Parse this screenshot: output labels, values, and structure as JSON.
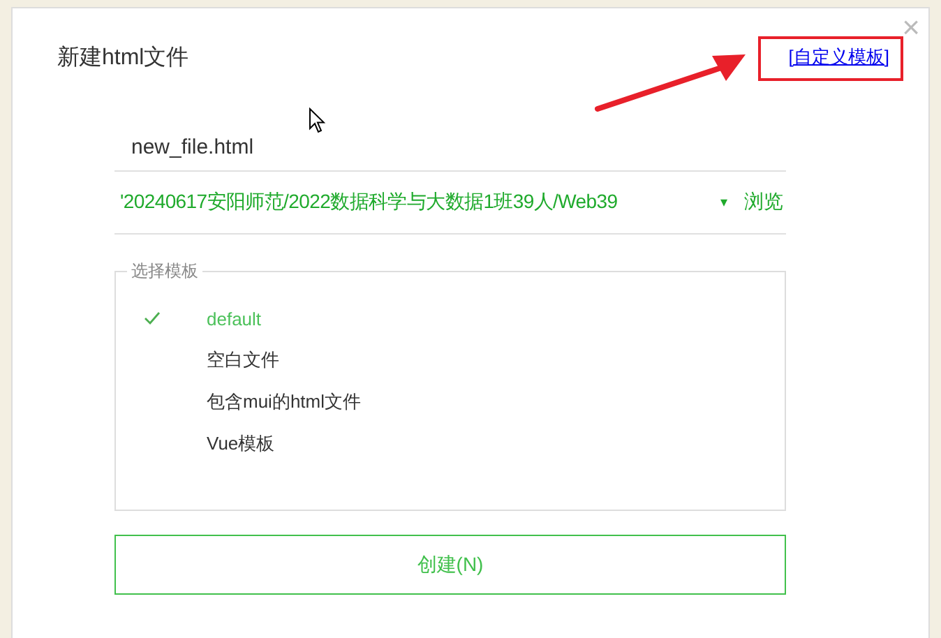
{
  "dialog": {
    "title": "新建html文件",
    "close": "×",
    "custom_template_link": "[自定义模板]"
  },
  "filename": {
    "value": "new_file.html"
  },
  "location": {
    "value": "'20240617安阳师范/2022数据科学与大数据1班39人/Web39",
    "dropdown": "▾",
    "browse": "浏览"
  },
  "templates": {
    "legend": "选择模板",
    "items": [
      {
        "label": "default",
        "selected": true
      },
      {
        "label": "空白文件",
        "selected": false
      },
      {
        "label": "包含mui的html文件",
        "selected": false
      },
      {
        "label": "Vue模板",
        "selected": false
      }
    ]
  },
  "create_button": "创建(N)"
}
